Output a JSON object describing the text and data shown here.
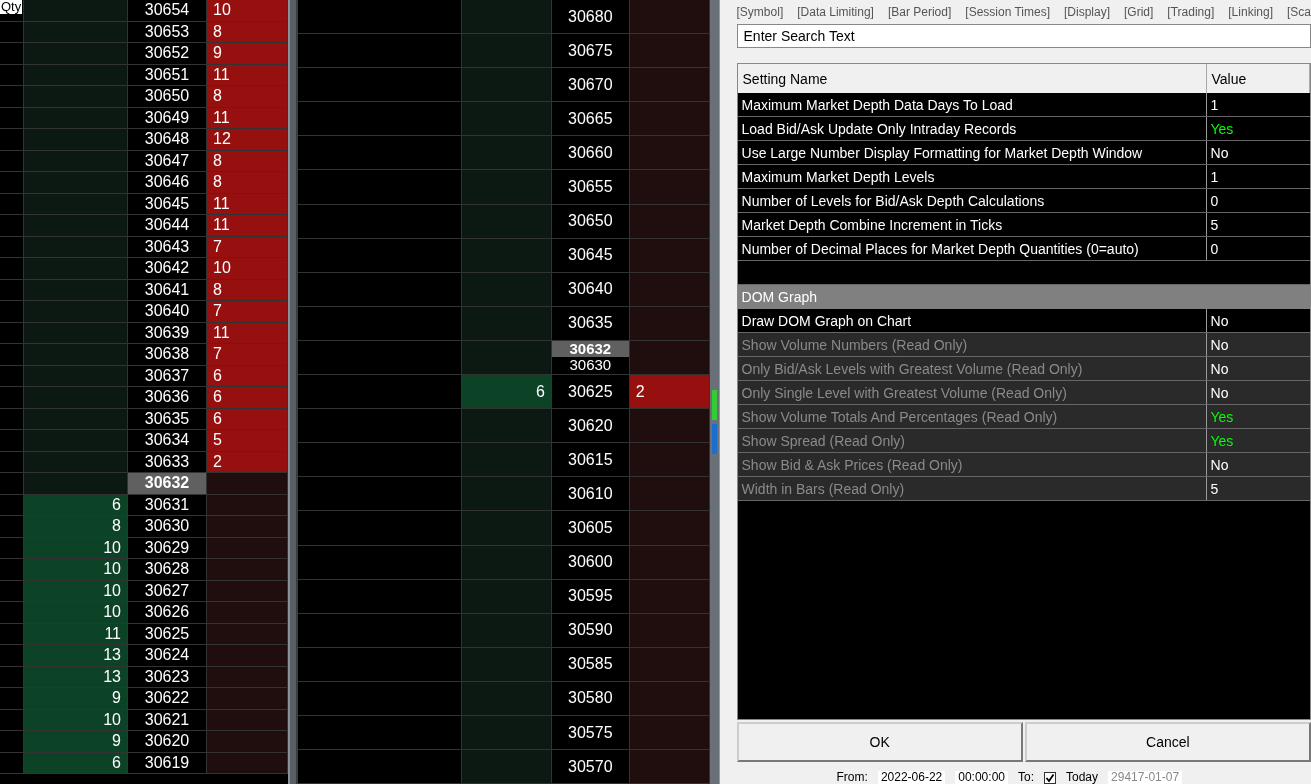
{
  "left_ladder": {
    "qty_label": "Qty",
    "rows": [
      {
        "price": "30654",
        "bid": "",
        "ask": "10",
        "current": false
      },
      {
        "price": "30653",
        "bid": "",
        "ask": "8",
        "current": false
      },
      {
        "price": "30652",
        "bid": "",
        "ask": "9",
        "current": false
      },
      {
        "price": "30651",
        "bid": "",
        "ask": "11",
        "current": false
      },
      {
        "price": "30650",
        "bid": "",
        "ask": "8",
        "current": false
      },
      {
        "price": "30649",
        "bid": "",
        "ask": "11",
        "current": false
      },
      {
        "price": "30648",
        "bid": "",
        "ask": "12",
        "current": false
      },
      {
        "price": "30647",
        "bid": "",
        "ask": "8",
        "current": false
      },
      {
        "price": "30646",
        "bid": "",
        "ask": "8",
        "current": false
      },
      {
        "price": "30645",
        "bid": "",
        "ask": "11",
        "current": false
      },
      {
        "price": "30644",
        "bid": "",
        "ask": "11",
        "current": false
      },
      {
        "price": "30643",
        "bid": "",
        "ask": "7",
        "current": false
      },
      {
        "price": "30642",
        "bid": "",
        "ask": "10",
        "current": false
      },
      {
        "price": "30641",
        "bid": "",
        "ask": "8",
        "current": false
      },
      {
        "price": "30640",
        "bid": "",
        "ask": "7",
        "current": false
      },
      {
        "price": "30639",
        "bid": "",
        "ask": "11",
        "current": false
      },
      {
        "price": "30638",
        "bid": "",
        "ask": "7",
        "current": false
      },
      {
        "price": "30637",
        "bid": "",
        "ask": "6",
        "current": false
      },
      {
        "price": "30636",
        "bid": "",
        "ask": "6",
        "current": false
      },
      {
        "price": "30635",
        "bid": "",
        "ask": "6",
        "current": false
      },
      {
        "price": "30634",
        "bid": "",
        "ask": "5",
        "current": false
      },
      {
        "price": "30633",
        "bid": "",
        "ask": "2",
        "current": false
      },
      {
        "price": "30632",
        "bid": "",
        "ask": "",
        "current": true
      },
      {
        "price": "30631",
        "bid": "6",
        "ask": "",
        "current": false
      },
      {
        "price": "30630",
        "bid": "8",
        "ask": "",
        "current": false
      },
      {
        "price": "30629",
        "bid": "10",
        "ask": "",
        "current": false
      },
      {
        "price": "30628",
        "bid": "10",
        "ask": "",
        "current": false
      },
      {
        "price": "30627",
        "bid": "10",
        "ask": "",
        "current": false
      },
      {
        "price": "30626",
        "bid": "10",
        "ask": "",
        "current": false
      },
      {
        "price": "30625",
        "bid": "11",
        "ask": "",
        "current": false
      },
      {
        "price": "30624",
        "bid": "13",
        "ask": "",
        "current": false
      },
      {
        "price": "30623",
        "bid": "13",
        "ask": "",
        "current": false
      },
      {
        "price": "30622",
        "bid": "9",
        "ask": "",
        "current": false
      },
      {
        "price": "30621",
        "bid": "10",
        "ask": "",
        "current": false
      },
      {
        "price": "30620",
        "bid": "9",
        "ask": "",
        "current": false
      },
      {
        "price": "30619",
        "bid": "6",
        "ask": "",
        "current": false
      }
    ]
  },
  "right_ladder": {
    "rows": [
      {
        "price": "30680",
        "bid": "",
        "ask": ""
      },
      {
        "price": "30675",
        "bid": "",
        "ask": ""
      },
      {
        "price": "30670",
        "bid": "",
        "ask": ""
      },
      {
        "price": "30665",
        "bid": "",
        "ask": ""
      },
      {
        "price": "30660",
        "bid": "",
        "ask": ""
      },
      {
        "price": "30655",
        "bid": "",
        "ask": ""
      },
      {
        "price": "30650",
        "bid": "",
        "ask": ""
      },
      {
        "price": "30645",
        "bid": "",
        "ask": ""
      },
      {
        "price": "30640",
        "bid": "",
        "ask": ""
      },
      {
        "price": "30635",
        "bid": "",
        "ask": ""
      },
      {
        "price": "30630",
        "bid": "",
        "ask": "",
        "current_price": "30632"
      },
      {
        "price": "30625",
        "bid": "6",
        "ask": "2"
      },
      {
        "price": "30620",
        "bid": "",
        "ask": ""
      },
      {
        "price": "30615",
        "bid": "",
        "ask": ""
      },
      {
        "price": "30610",
        "bid": "",
        "ask": ""
      },
      {
        "price": "30605",
        "bid": "",
        "ask": ""
      },
      {
        "price": "30600",
        "bid": "",
        "ask": ""
      },
      {
        "price": "30595",
        "bid": "",
        "ask": ""
      },
      {
        "price": "30590",
        "bid": "",
        "ask": ""
      },
      {
        "price": "30585",
        "bid": "",
        "ask": ""
      },
      {
        "price": "30580",
        "bid": "",
        "ask": ""
      },
      {
        "price": "30575",
        "bid": "",
        "ask": ""
      },
      {
        "price": "30570",
        "bid": "",
        "ask": ""
      }
    ]
  },
  "dialog": {
    "tabs": [
      "[Symbol]",
      "[Data Limiting]",
      "[Bar Period]",
      "[Session Times]",
      "[Display]",
      "[Grid]",
      "[Trading]",
      "[Linking]",
      "[Sca"
    ],
    "search": {
      "placeholder": "Enter Search Text"
    },
    "columns": [
      "Setting Name",
      "Value"
    ],
    "rows": [
      {
        "kind": "setting",
        "name": "Maximum Market Depth Data Days To Load",
        "value": "1",
        "read_only": false,
        "color": "#ffffff"
      },
      {
        "kind": "setting",
        "name": "Load Bid/Ask Update Only Intraday Records",
        "value": "Yes",
        "read_only": false,
        "color": "#00ff00"
      },
      {
        "kind": "setting",
        "name": "Use Large Number Display Formatting for Market Depth Window",
        "value": "No",
        "read_only": false,
        "color": "#ffffff"
      },
      {
        "kind": "setting",
        "name": "Maximum Market Depth Levels",
        "value": "1",
        "read_only": false,
        "color": "#ffffff"
      },
      {
        "kind": "setting",
        "name": "Number of Levels for Bid/Ask Depth Calculations",
        "value": "0",
        "read_only": false,
        "color": "#ffffff"
      },
      {
        "kind": "setting",
        "name": "Market Depth Combine Increment in Ticks",
        "value": "5",
        "read_only": false,
        "color": "#ffffff"
      },
      {
        "kind": "setting",
        "name": "Number of Decimal Places for Market Depth Quantities (0=auto)",
        "value": "0",
        "read_only": false,
        "color": "#ffffff"
      },
      {
        "kind": "blank"
      },
      {
        "kind": "section",
        "name": "DOM Graph"
      },
      {
        "kind": "setting",
        "name": "Draw DOM Graph on Chart",
        "value": "No",
        "read_only": false,
        "color": "#ffffff"
      },
      {
        "kind": "setting",
        "name": "Show Volume Numbers (Read Only)",
        "value": "No",
        "read_only": true,
        "color": "#ffffff"
      },
      {
        "kind": "setting",
        "name": "Only Bid/Ask Levels with Greatest Volume (Read Only)",
        "value": "No",
        "read_only": true,
        "color": "#ffffff"
      },
      {
        "kind": "setting",
        "name": "Only Single Level with Greatest Volume (Read Only)",
        "value": "No",
        "read_only": true,
        "color": "#ffffff"
      },
      {
        "kind": "setting",
        "name": "Show Volume Totals And Percentages (Read Only)",
        "value": "Yes",
        "read_only": true,
        "color": "#00ff00"
      },
      {
        "kind": "setting",
        "name": "Show Spread (Read Only)",
        "value": "Yes",
        "read_only": true,
        "color": "#00ff00"
      },
      {
        "kind": "setting",
        "name": "Show Bid & Ask Prices (Read Only)",
        "value": "No",
        "read_only": true,
        "color": "#ffffff"
      },
      {
        "kind": "setting",
        "name": "Width in Bars (Read Only)",
        "value": "5",
        "read_only": true,
        "color": "#ffffff"
      }
    ],
    "buttons": [
      "OK",
      "Cancel"
    ]
  },
  "bottom_bar": {
    "from_label": "From:",
    "from_date": "2022-06-22",
    "from_time": "00:00:00",
    "to_label": "To:",
    "today_checked": true,
    "today_label": "Today",
    "to_date": "29417-01-07"
  }
}
